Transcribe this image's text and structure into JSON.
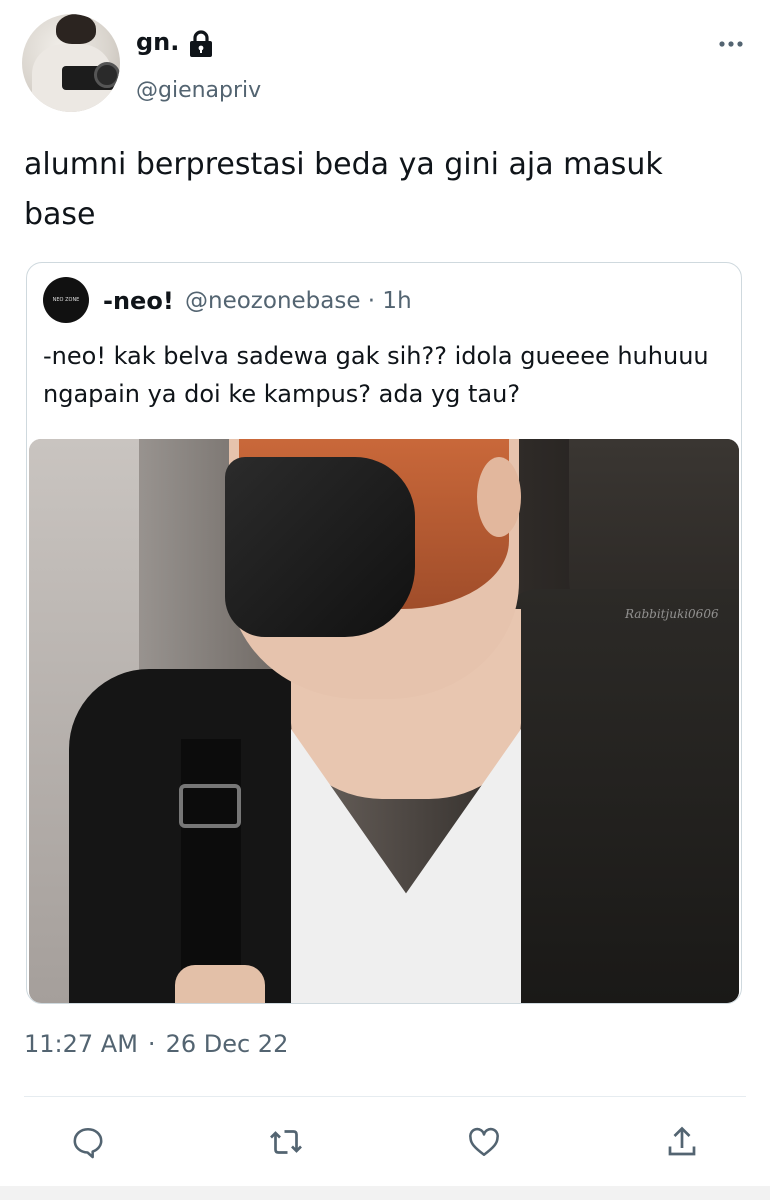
{
  "tweet": {
    "author_name": "gn.",
    "author_handle": "@gienapriv",
    "text": "alumni berprestasi beda ya gini aja masuk base",
    "timestamp": "11:27 AM",
    "date": "26 Dec 22",
    "separator": "·"
  },
  "quote": {
    "author_name": "-neo!",
    "author_handle": "@neozonebase · 1h",
    "avatar_logo_text": "NEO ZONE",
    "text": "-neo! kak belva sadewa gak sih?? idola gueeee huhuuu ngapain ya doi ke kampus? ada yg tau?",
    "image_watermark": "Rabbitjuki0606"
  },
  "icons": {
    "lock": "lock-icon",
    "more": "more-options-icon",
    "reply": "reply-icon",
    "retweet": "retweet-icon",
    "like": "like-icon",
    "share": "share-icon"
  },
  "colors": {
    "text": "#0f1419",
    "secondary": "#536471",
    "border": "#cfd9de"
  }
}
